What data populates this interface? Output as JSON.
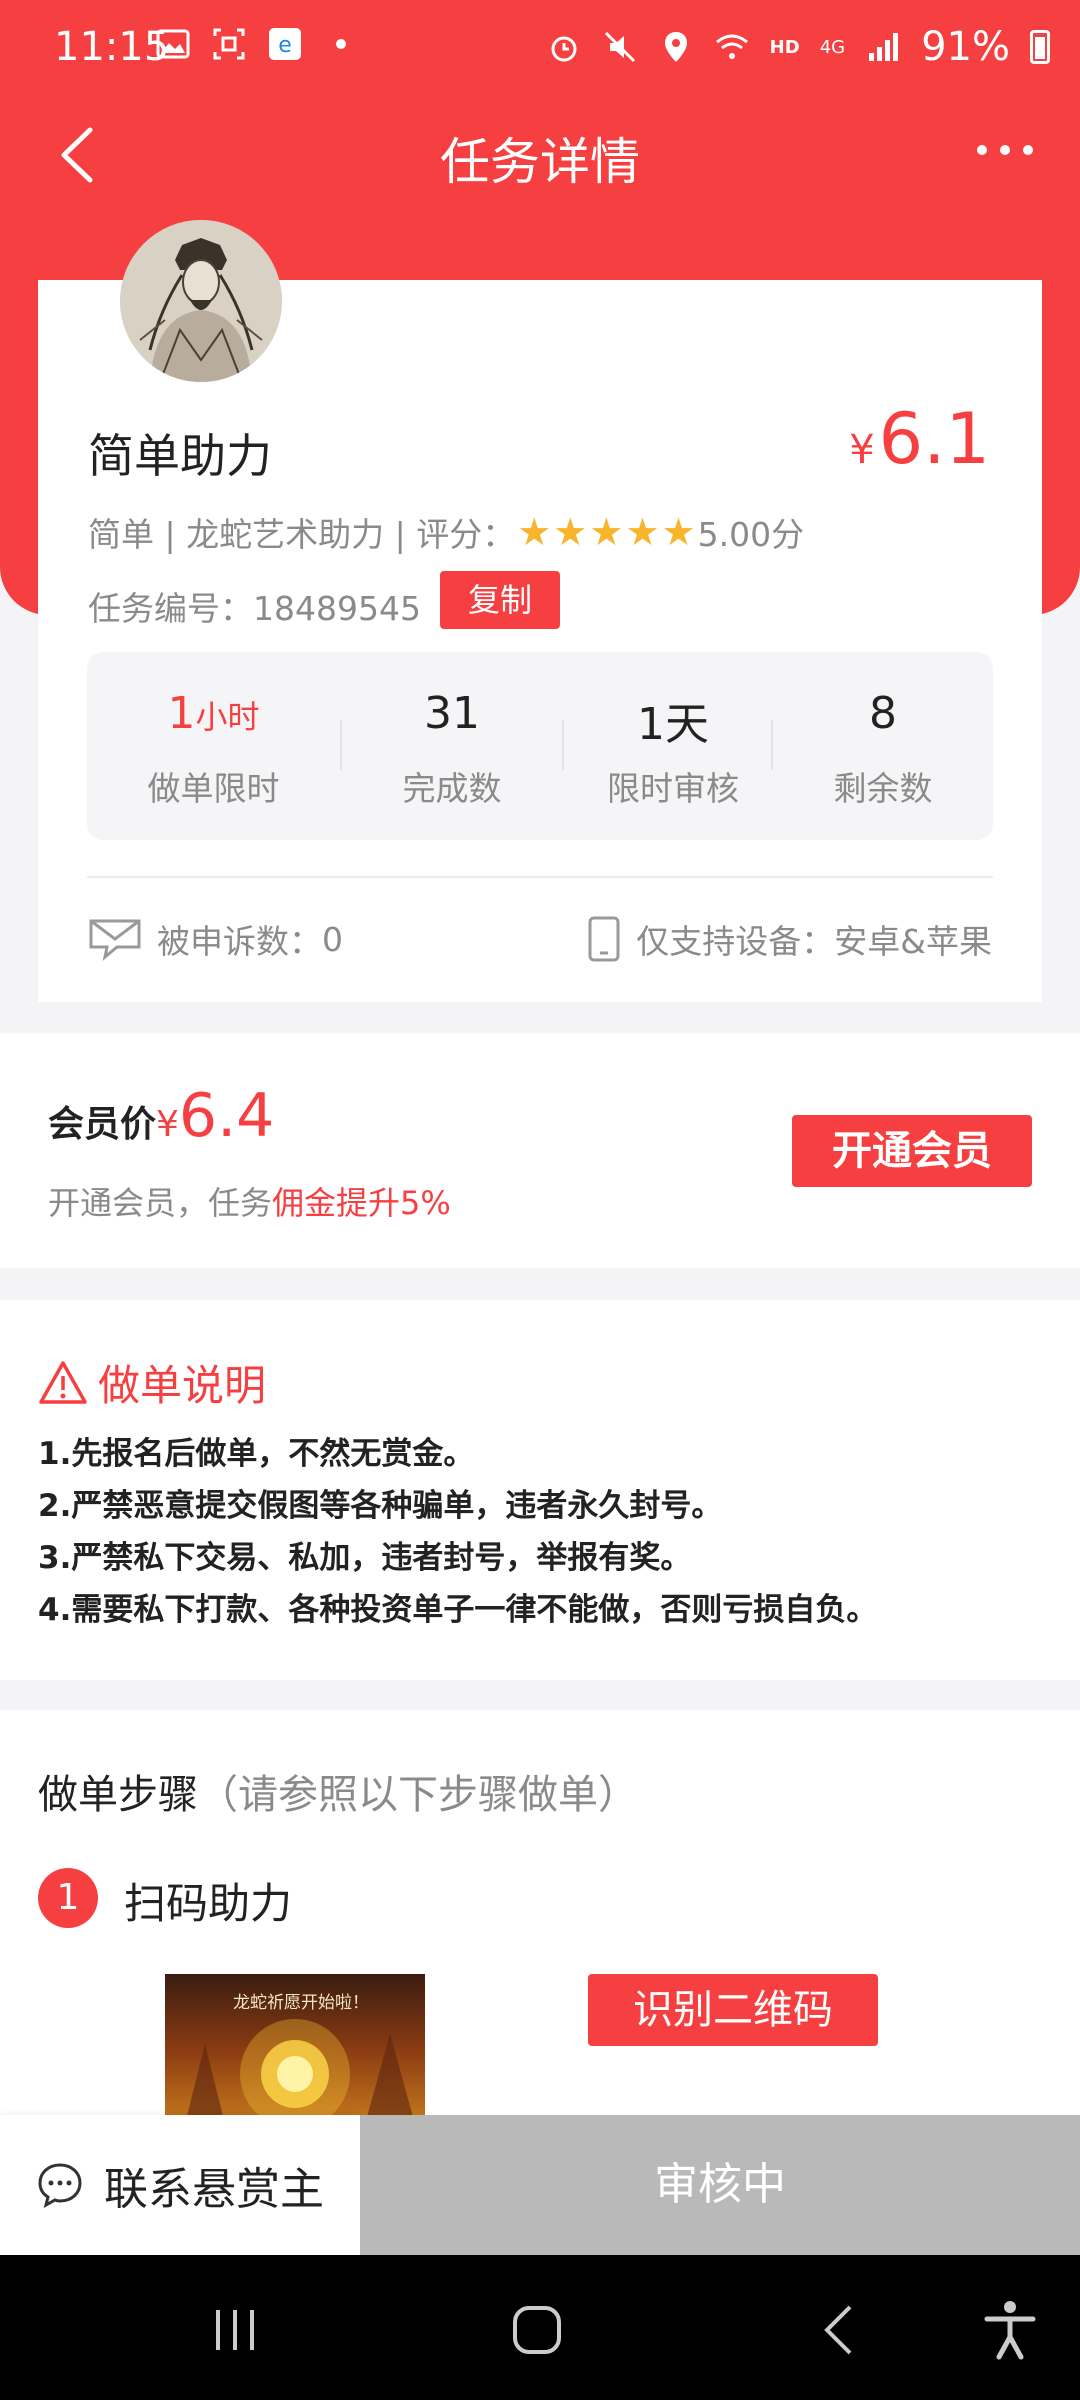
{
  "status_bar": {
    "time": "11:15",
    "network": "HD",
    "signal": "4G",
    "battery": "91%"
  },
  "nav": {
    "title": "任务详情"
  },
  "task": {
    "title": "简单助力",
    "price_symbol": "¥",
    "price": "6.1",
    "meta_prefix": "简单 | 龙蛇艺术助力 | 评分：",
    "rating": "5.00分",
    "rating_value": 5,
    "task_no_label": "任务编号：",
    "task_no": "18489545",
    "copy_label": "复制"
  },
  "stats": [
    {
      "value": "1",
      "unit": "小时",
      "label": "做单限时"
    },
    {
      "value": "31",
      "label": "完成数"
    },
    {
      "value": "1天",
      "label": "限时审核"
    },
    {
      "value": "8",
      "label": "剩余数"
    }
  ],
  "complaint": {
    "label": "被申诉数：",
    "value": "0"
  },
  "device": {
    "label": "仅支持设备：安卓&苹果"
  },
  "member": {
    "label": "会员价",
    "price_symbol": "¥",
    "price": "6.4",
    "sub_text": "开通会员，任务",
    "sub_highlight": "佣金提升5%",
    "button": "开通会员"
  },
  "instructions": {
    "title": "做单说明",
    "items": [
      "1.先报名后做单，不然无赏金。",
      "2.严禁恶意提交假图等各种骗单，违者永久封号。",
      "3.严禁私下交易、私加，违者封号，举报有奖。",
      "4.需要私下打款、各种投资单子一律不能做，否则亏损自负。"
    ]
  },
  "steps": {
    "title": "做单步骤",
    "subtitle": "（请参照以下步骤做单）",
    "step1_num": "1",
    "step1_text": "扫码助力",
    "image_text": "龙蛇祈愿开始啦！",
    "scan_button": "识别二维码"
  },
  "actions": {
    "contact": "联系悬赏主",
    "review": "审核中"
  },
  "colors": {
    "brand_red": "#f63f40",
    "disabled_gray": "#b9b9b9",
    "star_gold": "#f7b52b"
  }
}
